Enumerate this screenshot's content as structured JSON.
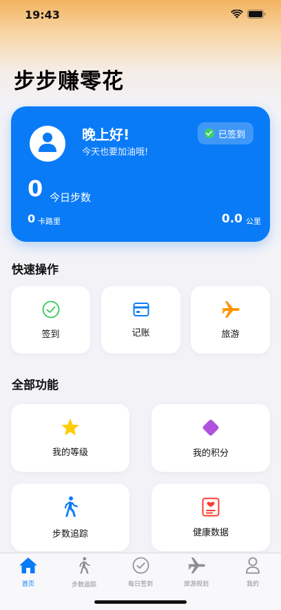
{
  "status_bar": {
    "time": "19:43"
  },
  "header": {
    "title": "步步赚零花"
  },
  "hero": {
    "greeting": "晚上好!",
    "subgreeting": "今天也要加油哦!",
    "checkin_badge": "已签到",
    "steps_value": "0",
    "steps_label": "今日步数",
    "calories_value": "0",
    "calories_label": "卡路里",
    "distance_value": "0.0",
    "distance_label": "公里",
    "color": "#0a7bf7"
  },
  "quick_actions": {
    "title": "快速操作",
    "items": [
      {
        "label": "签到",
        "icon": "checkmark-circle-icon",
        "color": "#34c759"
      },
      {
        "label": "记账",
        "icon": "card-icon",
        "color": "#0a7bf7"
      },
      {
        "label": "旅游",
        "icon": "airplane-icon",
        "color": "#ff9500"
      }
    ]
  },
  "all_features": {
    "title": "全部功能",
    "items": [
      {
        "label": "我的等级",
        "icon": "star-icon",
        "color": "#ffcc00"
      },
      {
        "label": "我的积分",
        "icon": "diamond-icon",
        "color": "#af52de"
      },
      {
        "label": "步数追踪",
        "icon": "walking-icon",
        "color": "#0a7bf7"
      },
      {
        "label": "健康数据",
        "icon": "health-record-icon",
        "color": "#ff3b30"
      }
    ]
  },
  "tab_bar": {
    "items": [
      {
        "label": "首页",
        "icon": "home-icon",
        "active": true
      },
      {
        "label": "步数追踪",
        "icon": "walking-icon",
        "active": false
      },
      {
        "label": "每日签到",
        "icon": "checkmark-circle-icon",
        "active": false
      },
      {
        "label": "旅游规划",
        "icon": "airplane-icon",
        "active": false
      },
      {
        "label": "我的",
        "icon": "person-icon",
        "active": false
      }
    ]
  }
}
